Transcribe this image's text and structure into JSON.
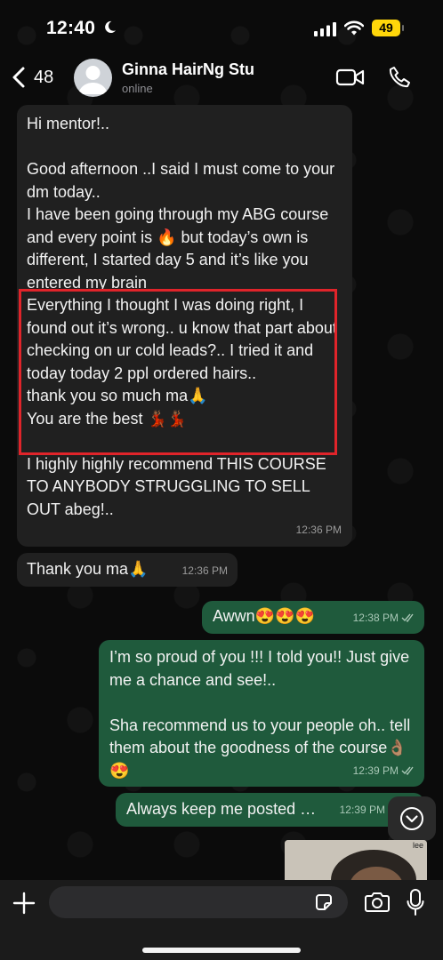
{
  "status_bar": {
    "time": "12:40",
    "battery": "49"
  },
  "header": {
    "back_count": "48",
    "contact_name": "Ginna HairNg Stu",
    "contact_status": "online"
  },
  "messages": [
    {
      "direction": "in",
      "text": "Hi mentor!..\n\nGood afternoon ..I said I must come to your dm today..\nI have been going through my ABG course and every point is 🔥 but today’s own is different, I started day 5 and it’s like you entered my brain\nEverything I thought I was doing right, I found out it’s wrong.. u know that part about checking on ur cold leads?.. I tried it and today today 2 ppl ordered hairs..\nthank you so much ma🙏\nYou are the best 💃🏾💃🏾\n\nI highly highly recommend THIS COURSE TO ANYBODY STRUGGLING TO SELL OUT abeg!..",
      "time": "12:36 PM"
    },
    {
      "direction": "in",
      "text": "Thank you ma🙏",
      "time": "12:36 PM"
    },
    {
      "direction": "out",
      "text": "Awwn😍😍😍",
      "time": "12:38 PM"
    },
    {
      "direction": "out",
      "text": "I’m so proud of you !!! I told you!! Just give me a chance and see!..\n\nSha recommend us to your people oh.. tell them about the goodness of the course👌🏽😍",
      "time": "12:39 PM"
    },
    {
      "direction": "out",
      "text": "Always keep me posted …",
      "time": "12:39 PM"
    }
  ],
  "attachment": {
    "label": "lee"
  },
  "input": {
    "placeholder": ""
  },
  "colors": {
    "incoming_bubble": "#202020",
    "outgoing_bubble": "#1f5a3c",
    "highlight_border": "#e0242a",
    "battery": "#ffd60a"
  }
}
